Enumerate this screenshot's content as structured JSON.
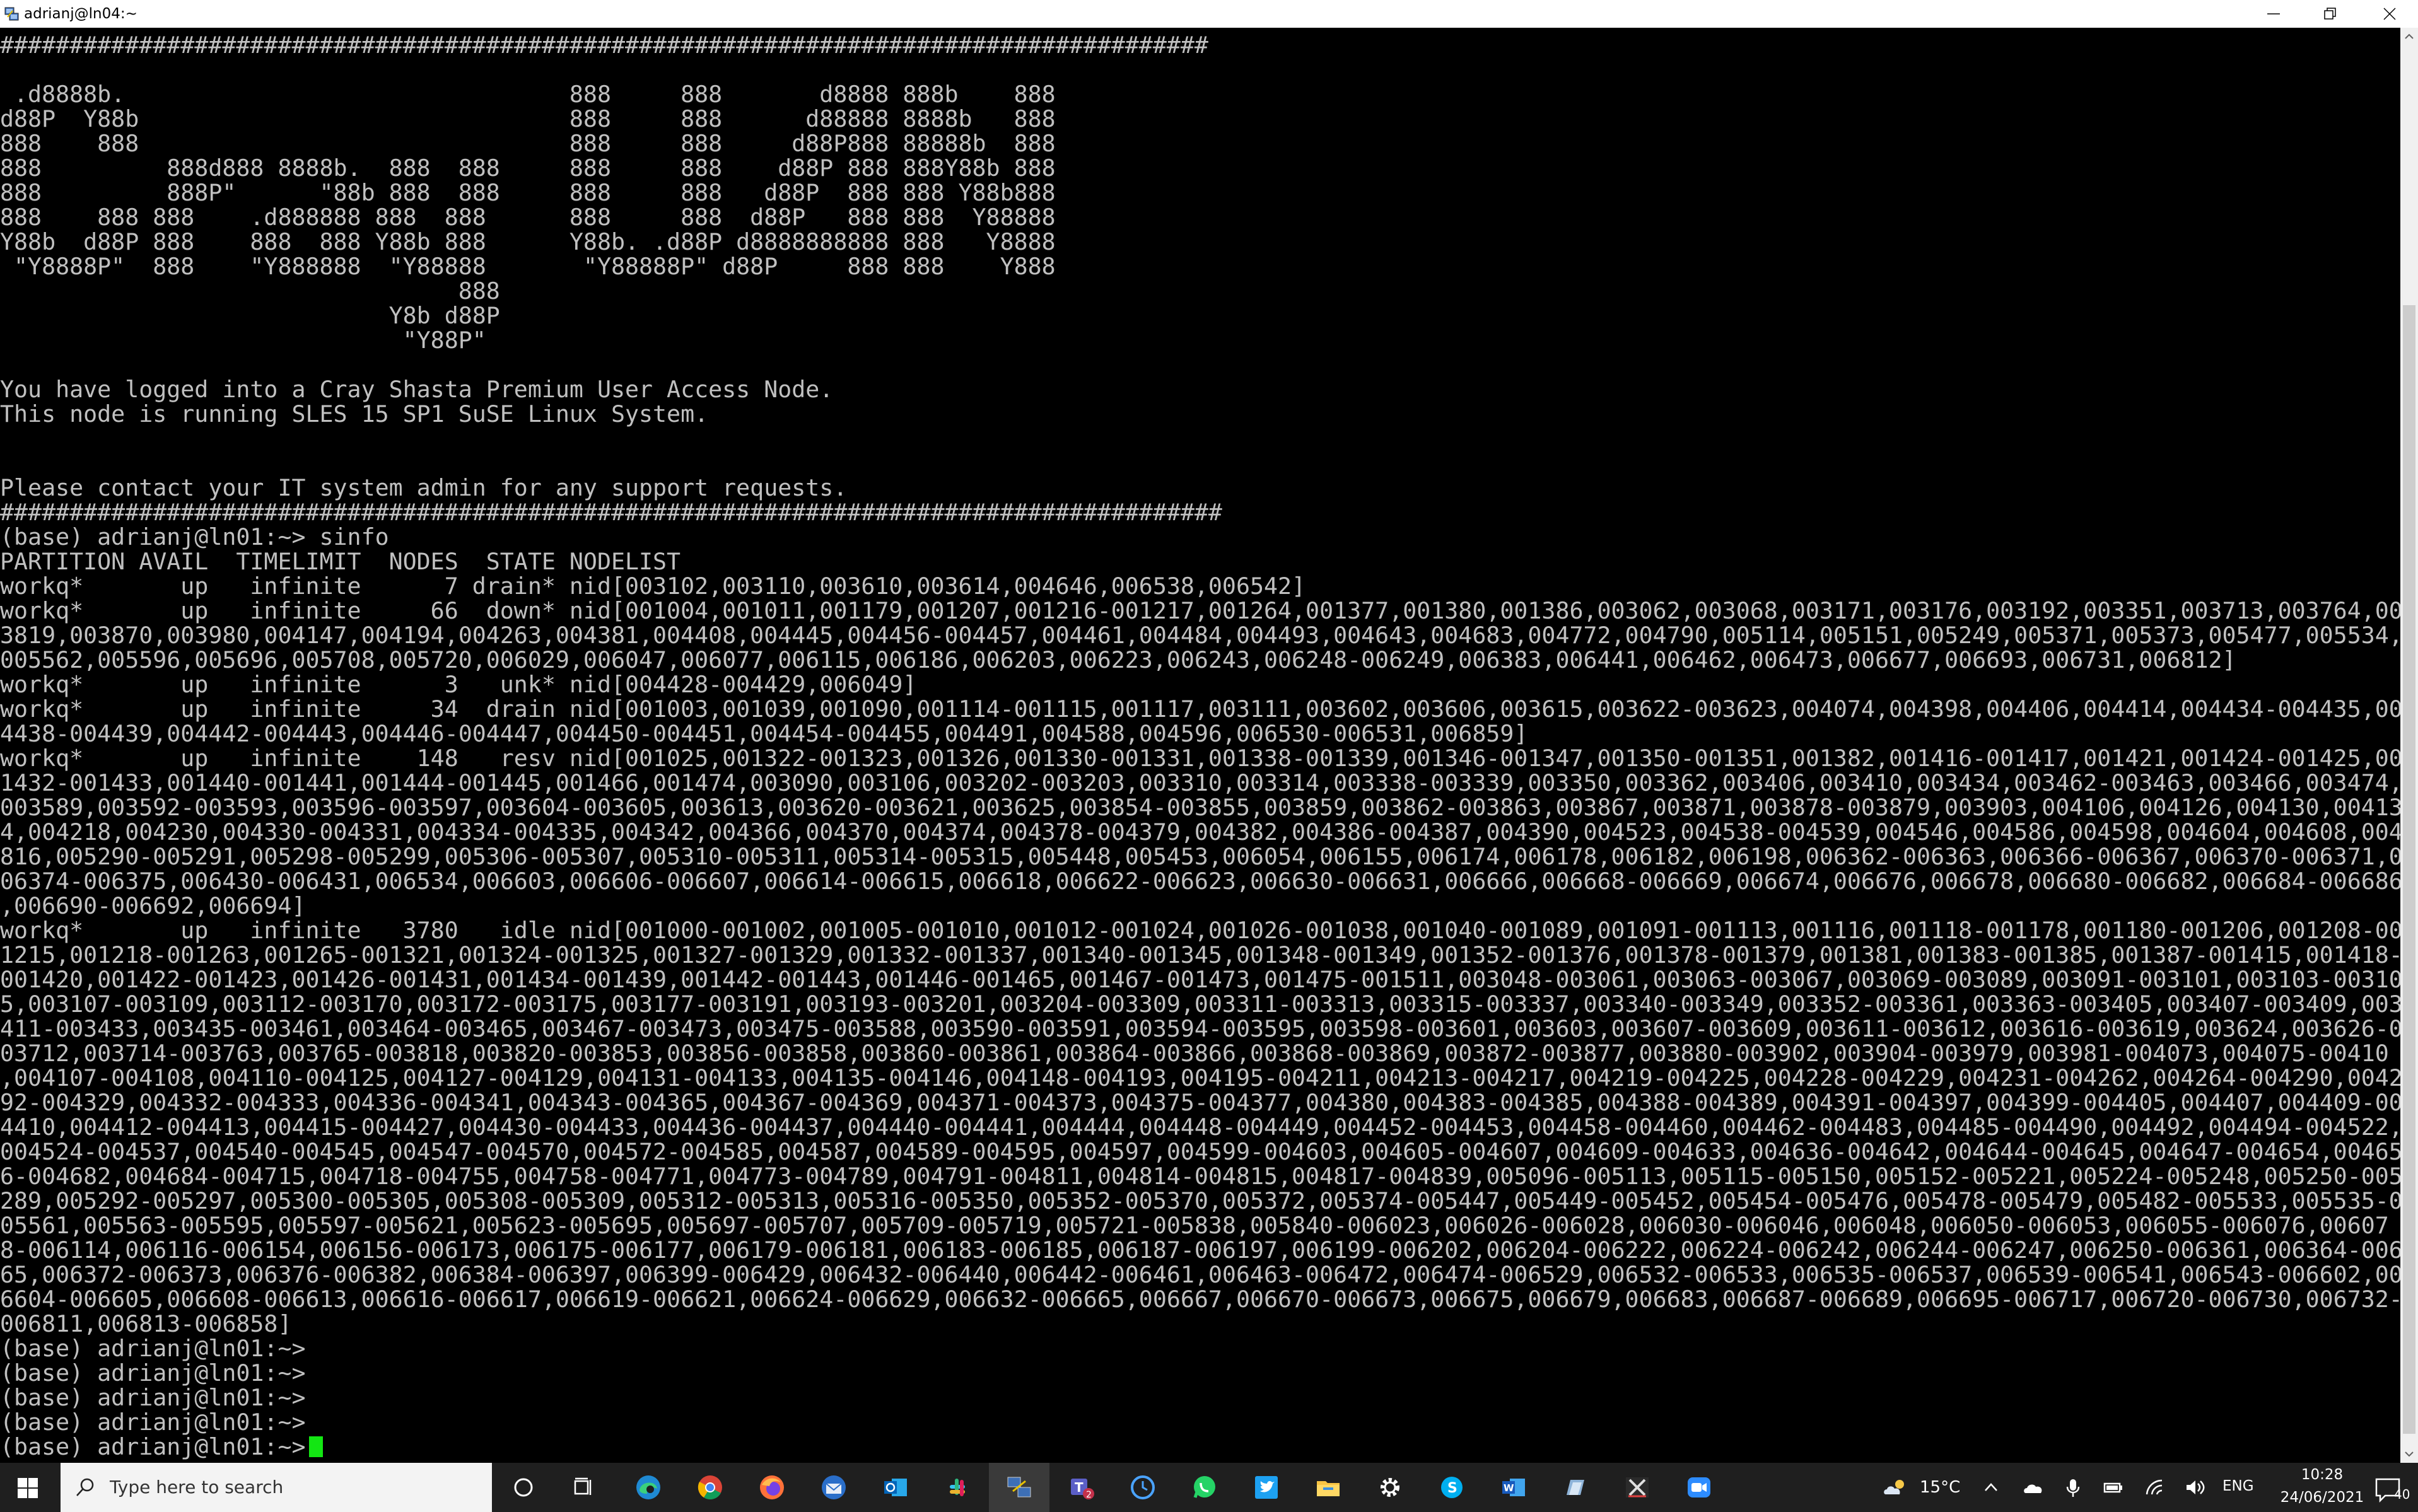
{
  "window": {
    "title": "adrianj@ln04:~"
  },
  "terminal": {
    "lines": [
      "#######################################################################################",
      "",
      " .d8888b.                                888     888       d8888 888b    888",
      "d88P  Y88b                               888     888      d88888 8888b   888",
      "888    888                               888     888     d88P888 88888b  888",
      "888         888d888 8888b.  888  888     888     888    d88P 888 888Y88b 888",
      "888         888P\"      \"88b 888  888     888     888   d88P  888 888 Y88b888",
      "888    888 888    .d888888 888  888      888     888  d88P   888 888  Y88888",
      "Y88b  d88P 888    888  888 Y88b 888      Y88b. .d88P d8888888888 888   Y8888",
      " \"Y8888P\"  888    \"Y888888  \"Y88888       \"Y88888P\" d88P     888 888    Y888",
      "                                 888",
      "                            Y8b d88P",
      "                             \"Y88P\"",
      "",
      "You have logged into a Cray Shasta Premium User Access Node.",
      "This node is running SLES 15 SP1 SuSE Linux System.",
      "",
      "",
      "Please contact your IT system admin for any support requests.",
      "########################################################################################",
      "(base) adrianj@ln01:~> sinfo",
      "PARTITION AVAIL  TIMELIMIT  NODES  STATE NODELIST",
      "workq*       up   infinite      7 drain* nid[003102,003110,003610,003614,004646,006538,006542]",
      "workq*       up   infinite     66  down* nid[001004,001011,001179,001207,001216-001217,001264,001377,001380,001386,003062,003068,003171,003176,003192,003351,003713,003764,00",
      "3819,003870,003980,004147,004194,004263,004381,004408,004445,004456-004457,004461,004484,004493,004643,004683,004772,004790,005114,005151,005249,005371,005373,005477,005534,",
      "005562,005596,005696,005708,005720,006029,006047,006077,006115,006186,006203,006223,006243,006248-006249,006383,006441,006462,006473,006677,006693,006731,006812]",
      "workq*       up   infinite      3   unk* nid[004428-004429,006049]",
      "workq*       up   infinite     34  drain nid[001003,001039,001090,001114-001115,001117,003111,003602,003606,003615,003622-003623,004074,004398,004406,004414,004434-004435,00",
      "4438-004439,004442-004443,004446-004447,004450-004451,004454-004455,004491,004588,004596,006530-006531,006859]",
      "workq*       up   infinite    148   resv nid[001025,001322-001323,001326,001330-001331,001338-001339,001346-001347,001350-001351,001382,001416-001417,001421,001424-001425,00",
      "1432-001433,001440-001441,001444-001445,001466,001474,003090,003106,003202-003203,003310,003314,003338-003339,003350,003362,003406,003410,003434,003462-003463,003466,003474,",
      "003589,003592-003593,003596-003597,003604-003605,003613,003620-003621,003625,003854-003855,003859,003862-003863,003867,003871,003878-003879,003903,004106,004126,004130,00413",
      "4,004218,004230,004330-004331,004334-004335,004342,004366,004370,004374,004378-004379,004382,004386-004387,004390,004523,004538-004539,004546,004586,004598,004604,004608,004",
      "816,005290-005291,005298-005299,005306-005307,005310-005311,005314-005315,005448,005453,006054,006155,006174,006178,006182,006198,006362-006363,006366-006367,006370-006371,0",
      "06374-006375,006430-006431,006534,006603,006606-006607,006614-006615,006618,006622-006623,006630-006631,006666,006668-006669,006674,006676,006678,006680-006682,006684-006686",
      ",006690-006692,006694]",
      "workq*       up   infinite   3780   idle nid[001000-001002,001005-001010,001012-001024,001026-001038,001040-001089,001091-001113,001116,001118-001178,001180-001206,001208-00",
      "1215,001218-001263,001265-001321,001324-001325,001327-001329,001332-001337,001340-001345,001348-001349,001352-001376,001378-001379,001381,001383-001385,001387-001415,001418-",
      "001420,001422-001423,001426-001431,001434-001439,001442-001443,001446-001465,001467-001473,001475-001511,003048-003061,003063-003067,003069-003089,003091-003101,003103-00310",
      "5,003107-003109,003112-003170,003172-003175,003177-003191,003193-003201,003204-003309,003311-003313,003315-003337,003340-003349,003352-003361,003363-003405,003407-003409,003",
      "411-003433,003435-003461,003464-003465,003467-003473,003475-003588,003590-003591,003594-003595,003598-003601,003603,003607-003609,003611-003612,003616-003619,003624,003626-0",
      "03712,003714-003763,003765-003818,003820-003853,003856-003858,003860-003861,003864-003866,003868-003869,003872-003877,003880-003902,003904-003979,003981-004073,004075-00410",
      ",004107-004108,004110-004125,004127-004129,004131-004133,004135-004146,004148-004193,004195-004211,004213-004217,004219-004225,004228-004229,004231-004262,004264-004290,0042",
      "92-004329,004332-004333,004336-004341,004343-004365,004367-004369,004371-004373,004375-004377,004380,004383-004385,004388-004389,004391-004397,004399-004405,004407,004409-00",
      "4410,004412-004413,004415-004427,004430-004433,004436-004437,004440-004441,004444,004448-004449,004452-004453,004458-004460,004462-004483,004485-004490,004492,004494-004522,",
      "004524-004537,004540-004545,004547-004570,004572-004585,004587,004589-004595,004597,004599-004603,004605-004607,004609-004633,004636-004642,004644-004645,004647-004654,00465",
      "6-004682,004684-004715,004718-004755,004758-004771,004773-004789,004791-004811,004814-004815,004817-004839,005096-005113,005115-005150,005152-005221,005224-005248,005250-005",
      "289,005292-005297,005300-005305,005308-005309,005312-005313,005316-005350,005352-005370,005372,005374-005447,005449-005452,005454-005476,005478-005479,005482-005533,005535-0",
      "05561,005563-005595,005597-005621,005623-005695,005697-005707,005709-005719,005721-005838,005840-006023,006026-006028,006030-006046,006048,006050-006053,006055-006076,00607",
      "8-006114,006116-006154,006156-006173,006175-006177,006179-006181,006183-006185,006187-006197,006199-006202,006204-006222,006224-006242,006244-006247,006250-006361,006364-0063",
      "65,006372-006373,006376-006382,006384-006397,006399-006429,006432-006440,006442-006461,006463-006472,006474-006529,006532-006533,006535-006537,006539-006541,006543-006602,00",
      "6604-006605,006608-006613,006616-006617,006619-006621,006624-006629,006632-006665,006667,006670-006673,006675,006679,006683,006687-006689,006695-006717,006720-006730,006732-",
      "006811,006813-006858]",
      "(base) adrianj@ln01:~>",
      "(base) adrianj@ln01:~>",
      "(base) adrianj@ln01:~>",
      "(base) adrianj@ln01:~>"
    ],
    "prompt": "(base) adrianj@ln01:~> "
  },
  "taskbar": {
    "search_placeholder": "Type here to search",
    "apps": [
      {
        "name": "cortana-icon"
      },
      {
        "name": "task-view-icon"
      },
      {
        "name": "edge-icon"
      },
      {
        "name": "chrome-icon"
      },
      {
        "name": "firefox-icon"
      },
      {
        "name": "thunderbird-icon"
      },
      {
        "name": "outlook-icon"
      },
      {
        "name": "slack-icon"
      },
      {
        "name": "network-terminal-icon"
      },
      {
        "name": "teams-icon",
        "badge": "2"
      },
      {
        "name": "clock-app-icon"
      },
      {
        "name": "whatsapp-icon"
      },
      {
        "name": "twitter-icon"
      },
      {
        "name": "file-explorer-icon"
      },
      {
        "name": "settings-icon"
      },
      {
        "name": "skype-icon"
      },
      {
        "name": "word-icon"
      },
      {
        "name": "putty-icon"
      },
      {
        "name": "xming-icon"
      },
      {
        "name": "zoom-icon"
      }
    ],
    "weather": "15°C",
    "language": "ENG",
    "time": "10:28",
    "date": "24/06/2021",
    "notification_count": "40"
  },
  "colors": {
    "terminal_bg": "#000000",
    "terminal_fg": "#c0c0c0",
    "cursor": "#13e613",
    "taskbar_bg": "#1f1f1f",
    "accent": "#76b9ed"
  }
}
